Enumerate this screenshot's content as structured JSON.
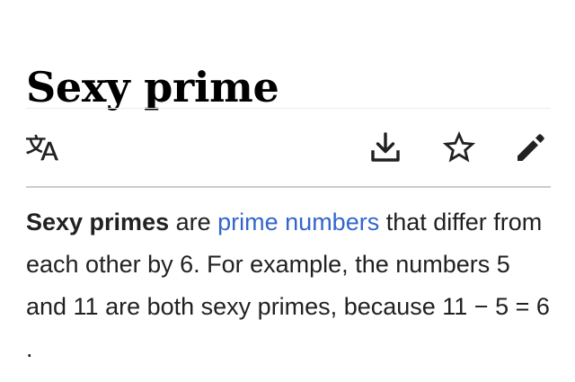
{
  "article": {
    "title": "Sexy prime",
    "lead": {
      "bold_term": "Sexy primes",
      "text_1": " are ",
      "link_text": "prime numbers",
      "text_2": " that differ from each other by 6. For example, the numbers 5 and 11 are both sexy primes, because 11 − 5 = 6 ."
    }
  },
  "toolbar": {
    "icons": [
      "language-icon",
      "download-icon",
      "star-icon",
      "edit-pencil-icon"
    ]
  },
  "colors": {
    "text": "#202122",
    "link": "#3366cc",
    "divider": "#c8ccd1",
    "icon": "#202122"
  }
}
